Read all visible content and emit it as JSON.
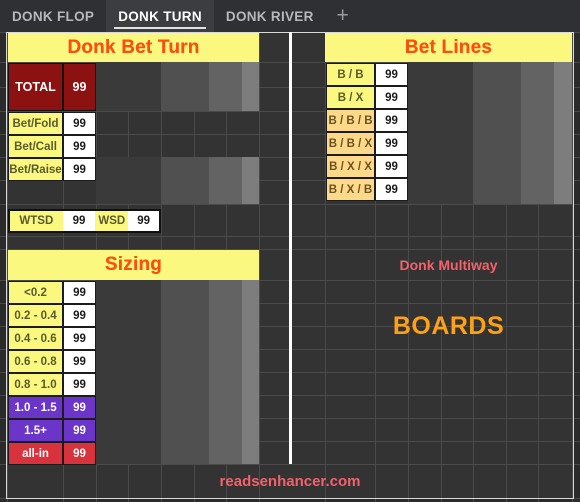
{
  "tabs": {
    "items": [
      {
        "label": "DONK FLOP",
        "active": false
      },
      {
        "label": "DONK TURN",
        "active": true
      },
      {
        "label": "DONK RIVER",
        "active": false
      }
    ],
    "add_label": "+"
  },
  "colors": {
    "header_bg": "#fbf87f",
    "header_text": "#ff4c11",
    "total_bg": "#8c1111",
    "amber": "#ffd98a",
    "purple": "#6b35c9",
    "red": "#d8323c",
    "boards_text": "#ffa114",
    "multiway_text": "#f4616b",
    "footer_text": "#f4616b",
    "sheet_bg": "#2b2b2b"
  },
  "left_panel": {
    "donk_bet_turn": {
      "title": "Donk Bet Turn",
      "total": {
        "label": "TOTAL",
        "value": "99"
      },
      "rows": [
        {
          "label": "Bet/Fold",
          "value": "99"
        },
        {
          "label": "Bet/Call",
          "value": "99"
        },
        {
          "label": "Bet/Raise",
          "value": "99"
        }
      ],
      "showdown": [
        {
          "label": "WTSD",
          "value": "99"
        },
        {
          "label": "WSD",
          "value": "99"
        }
      ]
    },
    "sizing": {
      "title": "Sizing",
      "rows": [
        {
          "label": "<0.2",
          "value": "99",
          "style": "yel"
        },
        {
          "label": "0.2 - 0.4",
          "value": "99",
          "style": "yel"
        },
        {
          "label": "0.4 - 0.6",
          "value": "99",
          "style": "yel"
        },
        {
          "label": "0.6 - 0.8",
          "value": "99",
          "style": "yel"
        },
        {
          "label": "0.8 - 1.0",
          "value": "99",
          "style": "yel"
        },
        {
          "label": "1.0 - 1.5",
          "value": "99",
          "style": "pur"
        },
        {
          "label": "1.5+",
          "value": "99",
          "style": "pur"
        },
        {
          "label": "all-in",
          "value": "99",
          "style": "red"
        }
      ]
    }
  },
  "right_panel": {
    "bet_lines": {
      "title": "Bet Lines",
      "rows": [
        {
          "label": "B / B",
          "value": "99",
          "style": "yel"
        },
        {
          "label": "B / X",
          "value": "99",
          "style": "yel"
        },
        {
          "label": "B / B / B",
          "value": "99",
          "style": "amb"
        },
        {
          "label": "B / B / X",
          "value": "99",
          "style": "amb"
        },
        {
          "label": "B / X / X",
          "value": "99",
          "style": "amb"
        },
        {
          "label": "B / X / B",
          "value": "99",
          "style": "amb"
        }
      ]
    },
    "multiway_title": "Donk Multiway",
    "boards_title": "BOARDS"
  },
  "footer": {
    "site": "readsenhancer.com"
  }
}
